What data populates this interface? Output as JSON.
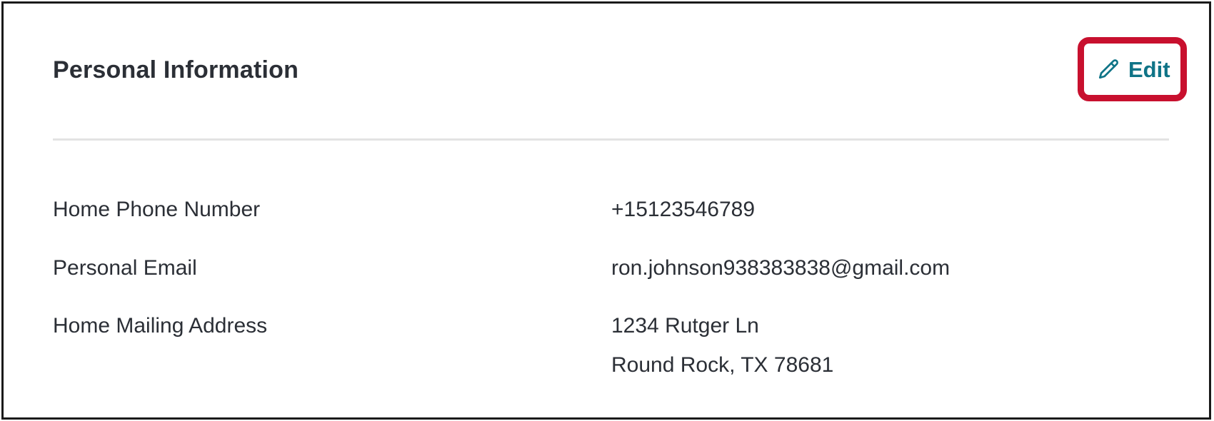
{
  "section": {
    "title": "Personal Information",
    "edit_label": "Edit"
  },
  "fields": {
    "home_phone": {
      "label": "Home Phone Number",
      "value": "+15123546789"
    },
    "personal_email": {
      "label": "Personal Email",
      "value": "ron.johnson938383838@gmail.com"
    },
    "home_mailing_address": {
      "label": "Home Mailing Address",
      "line1": "1234 Rutger Ln",
      "line2": "Round Rock, TX 78681"
    }
  },
  "colors": {
    "accent": "#0f7487",
    "highlight": "#c8102e",
    "text": "#2b2f36",
    "divider": "#e3e3e3"
  },
  "icons": {
    "edit": "pencil-icon"
  }
}
